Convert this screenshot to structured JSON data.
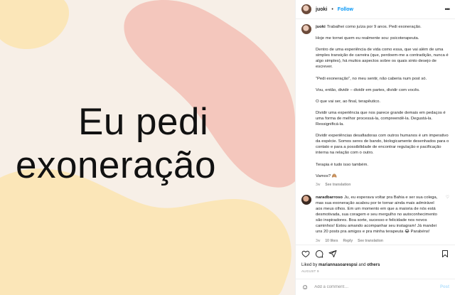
{
  "colors": {
    "bg": "#f7efe7",
    "peach": "#f4c7bd",
    "cream": "#fbe6b8",
    "follow": "#0095f6"
  },
  "image": {
    "line1": "Eu pedi",
    "line2": "exoneração"
  },
  "header": {
    "username": "juoki",
    "dot": "•",
    "follow": "Follow",
    "more_icon": "more-horizontal-icon"
  },
  "caption": {
    "username": "juoki",
    "paragraphs": [
      "Trabalhei como juíza por 9 anos. Pedi exoneração.",
      "Hoje me tornei quem eu realmente sou: psicoterapeuta.",
      "Dentro de uma experiência de vida como essa, que vai além de uma simples transição de carreira (que, perdoem-me a contradição, nunca é algo simples), há muitos aspectos sobre os quais sinto desejo de escrever.",
      "“Pedi exoneração”, no meu sentir, não caberia num post só.",
      "Vou, então, dividir – dividir em partes, dividir com vocês.",
      "O que vai ser, ao final, terapêutico.",
      "Dividir uma experiência que nos parece grande demais em pedaços é uma forma de melhor processá-la, compreendê-la. Degustá-la. Ressignificá-la.",
      "Dividir experiências desafiadoras com outros humanos é um imperativo da espécie. Somos seres de bando, biologicamente desenhados para o contato e para a possibilidade de encontrar regulação e pacificação interna na relação com o outro.",
      "Terapia é tudo isso também.",
      "Vamos? 🙈"
    ],
    "time": "3w",
    "see_translation": "See translation"
  },
  "comment": {
    "username": "naradbarroso",
    "text": "Ju, eu esperava voltar pra Bahia e ser sua colega, mas sua exoneração acabou por te tornar ainda mais admirável aos meus olhos. Em um momento em que a maioria de nós está desmotivada, sua coragem e seu mergulho no autoconhecimento são inspiradores. Boa sorte, sucesso e felicidade nos novos caminhos! Estou amando acompanhar seu instagram! Já mandei uns 20 posts pra amigos e pra minha terapeuta 😂 Parabéns!",
    "time": "3w",
    "likes": "10 likes",
    "reply": "Reply",
    "see_translation": "See translation"
  },
  "actions": {
    "like_icon": "heart-icon",
    "comment_icon": "comment-icon",
    "share_icon": "share-icon",
    "save_icon": "bookmark-icon"
  },
  "likes_line": {
    "prefix": "Liked by",
    "user": "mariannasoarespsi",
    "and": "and",
    "others": "others"
  },
  "date": "AUGUST 9",
  "add_comment": {
    "placeholder": "Add a comment…",
    "post": "Post"
  }
}
